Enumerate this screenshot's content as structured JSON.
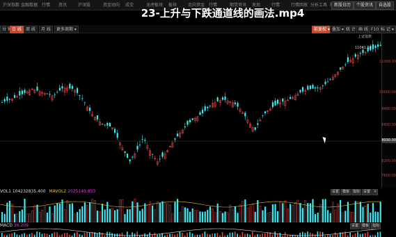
{
  "topbar": {
    "nav": [
      "沪深指数",
      "金融数据",
      "行情",
      "资讯",
      "沪深股",
      "资金动向",
      "成交",
      "龙虎板块",
      "板块",
      "北向资金",
      "行情",
      "期货资讯",
      "发现",
      "行情",
      "行情回放",
      "分析工具",
      "期货"
    ],
    "buttons": [
      "新股日历",
      "个股资讯",
      "自选股"
    ]
  },
  "title": "23-上升与下跌通道线的画法.mp4",
  "toolbar": {
    "left": [
      "分 钟",
      "日 线",
      "周 线",
      "月 线",
      "更多周期 ▾"
    ],
    "right": [
      "前复权 ▾",
      "叠加 ▾",
      "统 计",
      "画 线",
      "F10",
      "标 记 ▾",
      "+自选",
      "返 回"
    ],
    "index_label": "上证指数"
  },
  "price_axis": {
    "ticks": [
      "11000.00",
      "10000.00",
      "9400.00",
      "8800.00",
      "8200.00",
      "7600.00"
    ],
    "current": "8030.00",
    "high_label": "11041.18"
  },
  "volume": {
    "label": "VOL1",
    "value": "104232835.400",
    "ma_label": "MAVOL2",
    "ma_value": "2025149.853",
    "buttons": [
      "设置",
      "模板",
      "指标",
      "设置",
      "×"
    ]
  },
  "macd": {
    "label": "MACD",
    "value": "36.209",
    "buttons": [
      "设置",
      "模板",
      "指标"
    ]
  },
  "colors": {
    "up": "#e04848",
    "down": "#3fe8f0",
    "ma": "#d8d8d8",
    "bg": "#000000"
  }
}
